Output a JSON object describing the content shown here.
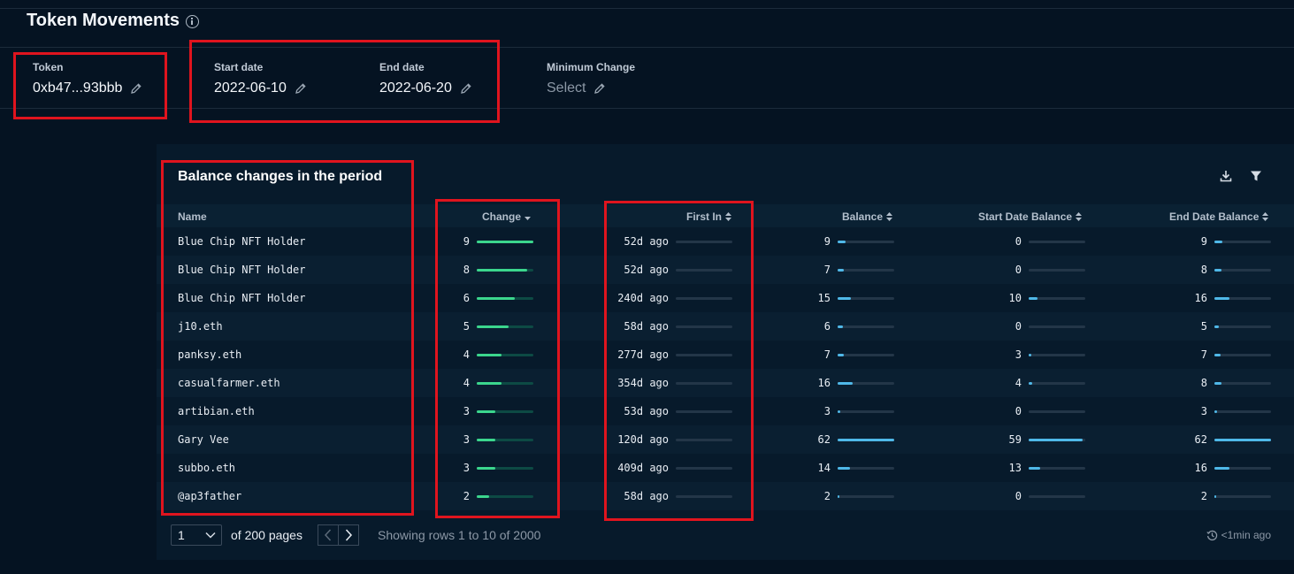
{
  "header": {
    "title": "Token Movements"
  },
  "params": {
    "token": {
      "label": "Token",
      "value": "0xb47...93bbb"
    },
    "start_date": {
      "label": "Start date",
      "value": "2022-06-10"
    },
    "end_date": {
      "label": "End date",
      "value": "2022-06-20"
    },
    "min_change": {
      "label": "Minimum Change",
      "value": "Select"
    }
  },
  "panel": {
    "title": "Balance changes in the period",
    "columns": {
      "name": "Name",
      "change": "Change",
      "first_in": "First In",
      "balance": "Balance",
      "start_balance": "Start Date Balance",
      "end_balance": "End Date Balance"
    },
    "rows": [
      {
        "name": "Blue Chip NFT Holder",
        "change": "9",
        "first_in": "52d ago",
        "balance": "9",
        "start_balance": "0",
        "end_balance": "9"
      },
      {
        "name": "Blue Chip NFT Holder",
        "change": "8",
        "first_in": "52d ago",
        "balance": "7",
        "start_balance": "0",
        "end_balance": "8"
      },
      {
        "name": "Blue Chip NFT Holder",
        "change": "6",
        "first_in": "240d ago",
        "balance": "15",
        "start_balance": "10",
        "end_balance": "16"
      },
      {
        "name": "j10.eth",
        "change": "5",
        "first_in": "58d ago",
        "balance": "6",
        "start_balance": "0",
        "end_balance": "5"
      },
      {
        "name": "panksy.eth",
        "change": "4",
        "first_in": "277d ago",
        "balance": "7",
        "start_balance": "3",
        "end_balance": "7"
      },
      {
        "name": "casualfarmer.eth",
        "change": "4",
        "first_in": "354d ago",
        "balance": "16",
        "start_balance": "4",
        "end_balance": "8"
      },
      {
        "name": "artibian.eth",
        "change": "3",
        "first_in": "53d ago",
        "balance": "3",
        "start_balance": "0",
        "end_balance": "3"
      },
      {
        "name": "Gary Vee",
        "change": "3",
        "first_in": "120d ago",
        "balance": "62",
        "start_balance": "59",
        "end_balance": "62"
      },
      {
        "name": "subbo.eth",
        "change": "3",
        "first_in": "409d ago",
        "balance": "14",
        "start_balance": "13",
        "end_balance": "16"
      },
      {
        "name": "@ap3father",
        "change": "2",
        "first_in": "58d ago",
        "balance": "2",
        "start_balance": "0",
        "end_balance": "2"
      }
    ]
  },
  "footer": {
    "page": "1",
    "of_pages": "of 200 pages",
    "showing": "Showing rows 1 to 10 of 2000",
    "updated": "<1min ago"
  },
  "colors": {
    "accent_green": "#3bd68d",
    "highlight_red": "#e0141e",
    "background": "#051322"
  }
}
